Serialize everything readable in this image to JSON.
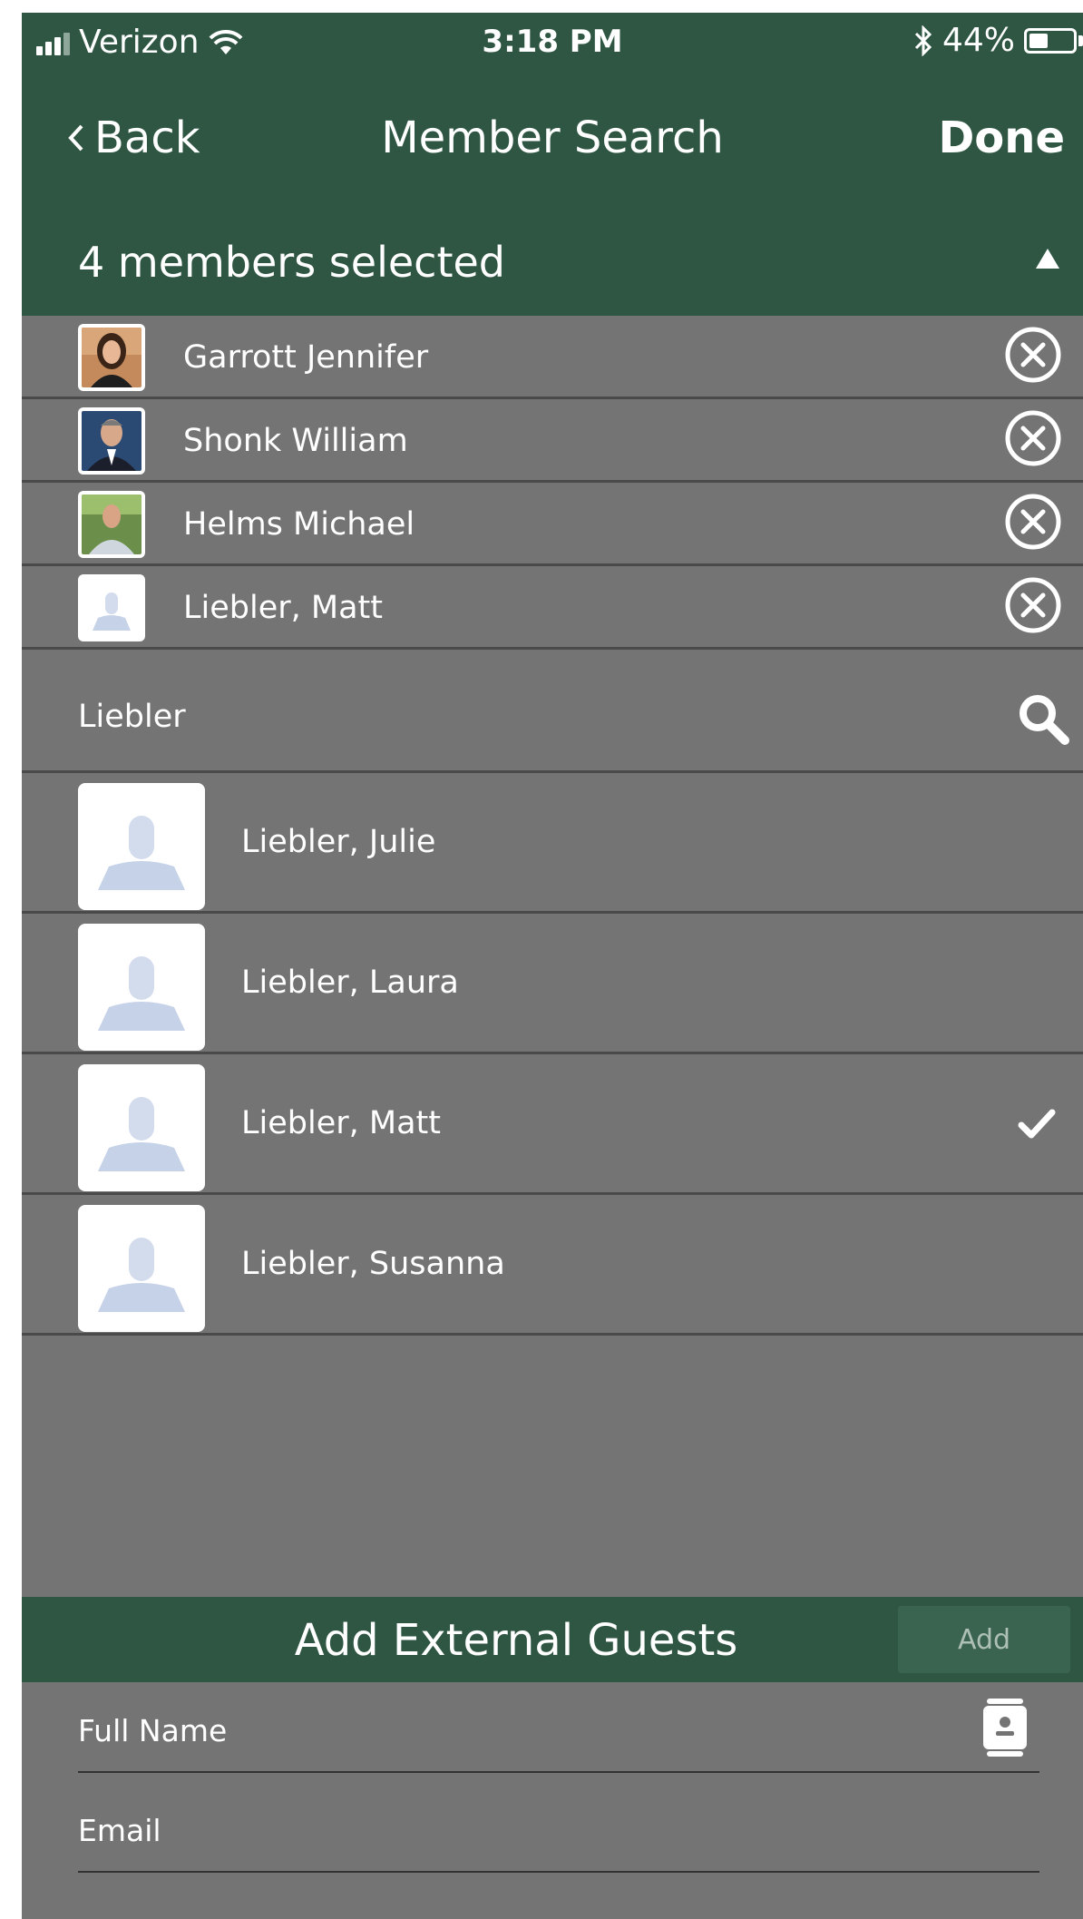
{
  "status_bar": {
    "carrier": "Verizon",
    "time": "3:18 PM",
    "battery": "44%",
    "battery_level": 0.44
  },
  "nav": {
    "back_label": "Back",
    "title": "Member Search",
    "done_label": "Done"
  },
  "selected": {
    "header": "4 members selected",
    "members": [
      {
        "name": "Garrott Jennifer"
      },
      {
        "name": "Shonk William"
      },
      {
        "name": "Helms Michael"
      },
      {
        "name": "Liebler, Matt"
      }
    ]
  },
  "search": {
    "query": "Liebler"
  },
  "results": [
    {
      "name": "Liebler, Julie",
      "checked": false
    },
    {
      "name": "Liebler, Laura",
      "checked": false
    },
    {
      "name": "Liebler, Matt",
      "checked": true
    },
    {
      "name": "Liebler, Susanna",
      "checked": false
    }
  ],
  "guests": {
    "title": "Add External Guests",
    "add_label": "Add",
    "name_placeholder": "Full Name",
    "email_placeholder": "Email"
  },
  "colors": {
    "header_green": "#2e5643",
    "background_gray": "#747474"
  }
}
